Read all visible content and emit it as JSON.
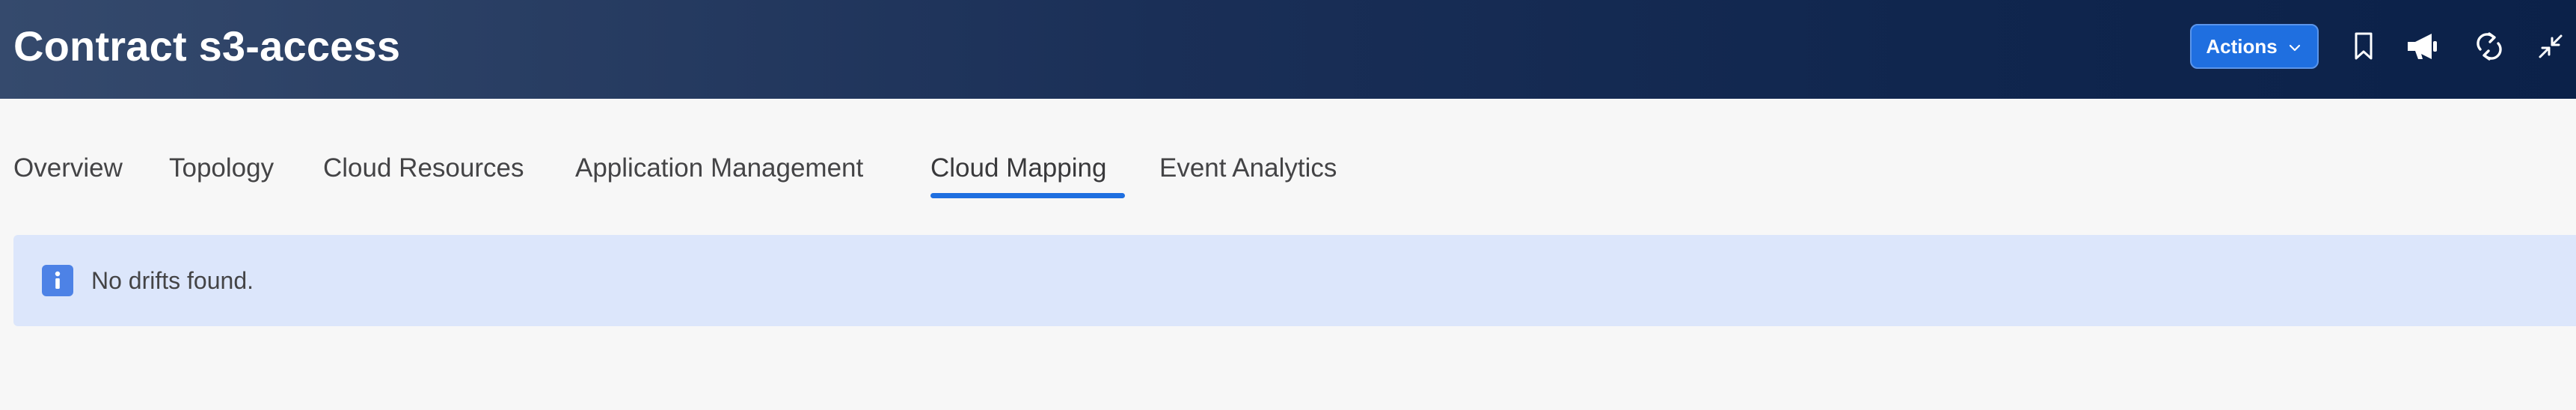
{
  "header": {
    "title": "Contract s3-access",
    "actions_label": "Actions",
    "icons": [
      "bookmark-icon",
      "megaphone-icon",
      "refresh-icon",
      "collapse-icon"
    ],
    "colors": {
      "background_start": "#354a6d",
      "background_end": "#0b2149",
      "button": "#1f6fe0"
    }
  },
  "tabs": {
    "items": [
      {
        "label": "Overview"
      },
      {
        "label": "Topology"
      },
      {
        "label": "Cloud Resources"
      },
      {
        "label": "Application Management"
      },
      {
        "label": "Cloud Mapping"
      },
      {
        "label": "Event Analytics"
      }
    ],
    "active": "Cloud Mapping",
    "accent_color": "#1f6fe0"
  },
  "alert": {
    "message": "No drifts found.",
    "icon": "info-icon",
    "background_color": "#dce6fb"
  }
}
